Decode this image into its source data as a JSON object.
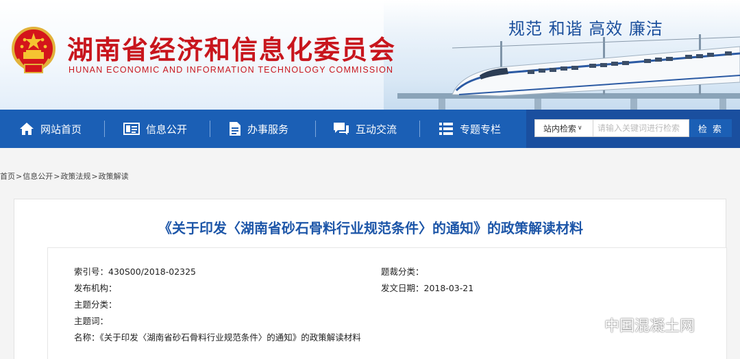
{
  "header": {
    "title_cn": "湖南省经济和信息化委员会",
    "title_en": "HUNAN ECONOMIC AND INFORMATION TECHNOLOGY COMMISSION",
    "motto": "规范 和谐 高效 廉洁",
    "brand_color": "#c8161d",
    "emblem_icon": "national-emblem-icon"
  },
  "nav": {
    "items": [
      {
        "label": "网站首页",
        "icon": "home-icon"
      },
      {
        "label": "信息公开",
        "icon": "info-card-icon"
      },
      {
        "label": "办事服务",
        "icon": "document-icon"
      },
      {
        "label": "互动交流",
        "icon": "chat-icon"
      },
      {
        "label": "专题专栏",
        "icon": "list-icon"
      }
    ],
    "bg_color": "#1b5fb5"
  },
  "search": {
    "scope_selected": "站内检索",
    "placeholder": "请输入关键词进行检索",
    "button_label": "检 索"
  },
  "breadcrumb": [
    "首页",
    "信息公开",
    "政策法规",
    "政策解读"
  ],
  "document": {
    "title": "《关于印发〈湖南省砂石骨料行业规范条件〉的通知》的政策解读材料",
    "title_color": "#1d56a8",
    "meta": {
      "index_label": "索引号：",
      "index_value": "430S00/2018-02325",
      "genre_label": "题裁分类：",
      "genre_value": "",
      "issuer_label": "发布机构：",
      "issuer_value": "",
      "date_label": "发文日期：",
      "date_value": "2018-03-21",
      "topic_label": "主题分类：",
      "topic_value": "",
      "keywords_label": "主题词：",
      "keywords_value": "",
      "name_label": "名称：",
      "name_value": "《关于印发〈湖南省砂石骨料行业规范条件〉的通知》的政策解读材料"
    }
  },
  "watermark": {
    "text": "中国混凝土网",
    "icon": "wechat-icon"
  }
}
